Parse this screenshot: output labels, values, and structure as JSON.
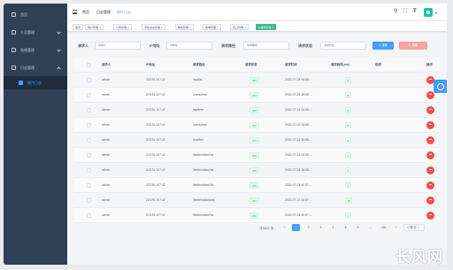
{
  "sidebar": {
    "items": [
      {
        "label": "首页",
        "icon": "home-icon"
      },
      {
        "label": "人员管理",
        "icon": "user-icon"
      },
      {
        "label": "系统管理",
        "icon": "grid-icon"
      },
      {
        "label": "日志管理",
        "icon": "grid-icon",
        "expanded": true
      },
      {
        "label": "操作日志",
        "icon": "file-icon",
        "active": true
      }
    ]
  },
  "header": {
    "breadcrumb": [
      "首页",
      "日志管理",
      "操作日志"
    ],
    "icons": [
      "search-icon",
      "fullscreen-icon",
      "font-size-icon",
      "avatar"
    ]
  },
  "tags": [
    {
      "label": "首页",
      "closable": false
    },
    {
      "label": "用户管理",
      "closable": true
    },
    {
      "label": "公告管理",
      "closable": true
    },
    {
      "label": "字段关系管理",
      "closable": true
    },
    {
      "label": "角色管理",
      "closable": true
    },
    {
      "label": "菜单管理",
      "closable": true
    },
    {
      "label": "接口管理",
      "closable": true
    },
    {
      "label": "操作日志",
      "closable": true,
      "active": true
    }
  ],
  "filters": {
    "requester": {
      "label": "请求人",
      "placeholder": "请求人"
    },
    "ip": {
      "label": "IP地址",
      "placeholder": "IP地址"
    },
    "path": {
      "label": "请求路径",
      "placeholder": "请求路径"
    },
    "status": {
      "label": "请求状态",
      "placeholder": "请求状态"
    },
    "search_button": "搜索",
    "reset_button": "重置"
  },
  "table": {
    "columns": [
      "请求人",
      "IP地址",
      "请求路径",
      "请求状态",
      "请求时间",
      "请求耗时(ms)",
      "说明",
      "操作"
    ],
    "rows": [
      {
        "user": "admin",
        "ip": "223.91.107.42",
        "path": "/api/list",
        "status": "200",
        "time": "2022-07-24 16:58:...",
        "ms": "3",
        "note": ""
      },
      {
        "user": "admin",
        "ip": "223.91.107.42",
        "path": "/menu/tree",
        "status": "200",
        "time": "2022-07-24 16:58:...",
        "ms": "5",
        "note": ""
      },
      {
        "user": "admin",
        "ip": "223.91.107.42",
        "path": "/api/tree",
        "status": "200",
        "time": "2022-07-24 16:58:...",
        "ms": "3",
        "note": ""
      },
      {
        "user": "admin",
        "ip": "223.91.107.42",
        "path": "/menu/tree",
        "status": "200",
        "time": "2022-07-24 16:58:...",
        "ms": "5",
        "note": ""
      },
      {
        "user": "admin",
        "ip": "223.91.107.42",
        "path": "/role/list",
        "status": "200",
        "time": "2022-07-24 16:58:...",
        "ms": "1",
        "note": ""
      },
      {
        "user": "admin",
        "ip": "223.91.107.42",
        "path": "/fieldrelation/list",
        "status": "200",
        "time": "2022-07-24 16:58:...",
        "ms": "1",
        "note": ""
      },
      {
        "user": "admin",
        "ip": "223.91.107.42",
        "path": "/fieldrelation/list",
        "status": "200",
        "time": "2022-07-24 16:58:...",
        "ms": "1",
        "note": ""
      },
      {
        "user": "admin",
        "ip": "223.91.107.42",
        "path": "/fieldrelation/list",
        "status": "200",
        "time": "2022-07-24 16:57:...",
        "ms": "1",
        "note": ""
      },
      {
        "user": "admin",
        "ip": "223.91.107.42",
        "path": "/fieldrelation/add",
        "status": "200",
        "time": "2022-07-24 16:57:...",
        "ms": "28",
        "note": ""
      },
      {
        "user": "admin",
        "ip": "223.91.107.42",
        "path": "/fieldrelation/list",
        "status": "200",
        "time": "2022-07-24 16:57:...",
        "ms": "1",
        "note": ""
      }
    ]
  },
  "pagination": {
    "total": "共 4341 条",
    "pages": [
      "1",
      "2",
      "3",
      "4",
      "5",
      "6",
      "...",
      "435"
    ],
    "current": "1",
    "page_size": "10条/页"
  },
  "watermark": "长风网"
}
